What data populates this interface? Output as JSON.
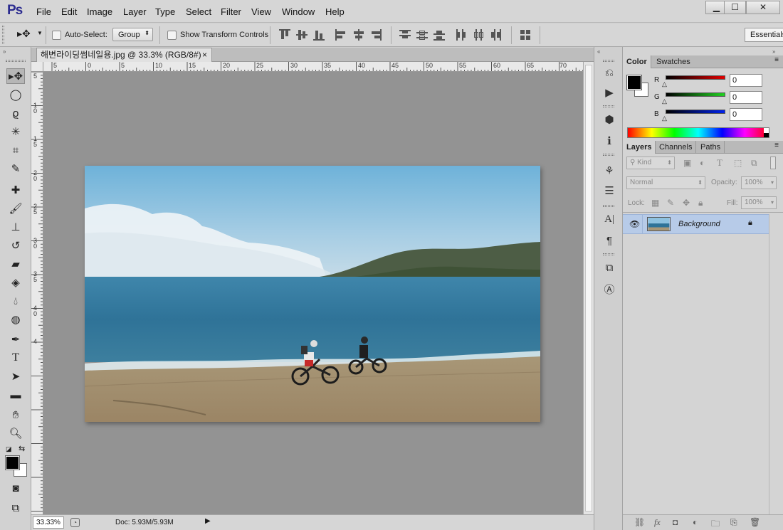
{
  "app": {
    "logo": "Ps"
  },
  "menu": [
    "File",
    "Edit",
    "Image",
    "Layer",
    "Type",
    "Select",
    "Filter",
    "View",
    "Window",
    "Help"
  ],
  "window_controls": {
    "minimize": "▁",
    "maximize": "☐",
    "close": "✕"
  },
  "options": {
    "auto_select_label": "Auto-Select:",
    "auto_select_mode": "Group",
    "show_transform_label": "Show Transform Controls",
    "workspace": "Essentials"
  },
  "document": {
    "tab_title": "해변라이딩썸네일용.jpg @ 33.3% (RGB/8#)",
    "close": "×",
    "h_ruler": [
      "5",
      "0",
      "5",
      "10",
      "15",
      "20",
      "25",
      "30",
      "35",
      "40",
      "45",
      "50",
      "55",
      "60",
      "65",
      "70"
    ],
    "v_ruler": [
      "5",
      "1",
      "0",
      "1",
      "5",
      "2",
      "0",
      "2",
      "5",
      "3",
      "0",
      "3",
      "5",
      "4",
      "0",
      "4"
    ]
  },
  "status": {
    "zoom": "33.33%",
    "doc_info": "Doc: 5.93M/5.93M"
  },
  "color_panel": {
    "tabs": [
      "Color",
      "Swatches"
    ],
    "active_tab": "Color",
    "channels": [
      {
        "label": "R",
        "value": "0",
        "color": "#d40000"
      },
      {
        "label": "G",
        "value": "0",
        "color": "#22c122"
      },
      {
        "label": "B",
        "value": "0",
        "color": "#0018c8"
      }
    ]
  },
  "layers_panel": {
    "tabs": [
      "Layers",
      "Channels",
      "Paths"
    ],
    "active_tab": "Layers",
    "kind_label": "Kind",
    "blend_mode": "Normal",
    "opacity_label": "Opacity:",
    "opacity": "100%",
    "lock_label": "Lock:",
    "fill_label": "Fill:",
    "fill": "100%",
    "layers": [
      {
        "name": "Background",
        "visible": true,
        "locked": true
      }
    ]
  },
  "colors": {
    "foreground": "#000000",
    "background": "#ffffff",
    "selection": "#b7cbe8"
  }
}
